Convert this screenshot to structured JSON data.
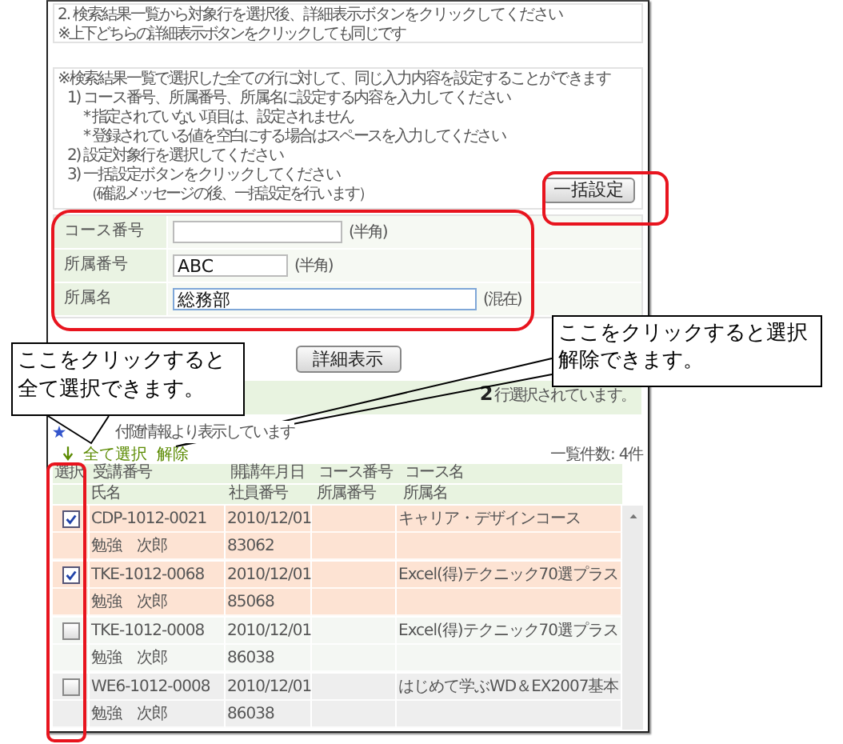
{
  "top_instructions": {
    "title": "2. 検索結果一覧から対象行を選択後、詳細表示ボタンをクリックしてください",
    "note": "※上下どちらの詳細表示ボタンをクリックしても同じです"
  },
  "bulk_instructions": [
    {
      "kind": "lead",
      "text": "※検索結果一覧で選択した全ての行に対して、同じ入力内容を設定することができます"
    },
    {
      "kind": "step",
      "text": "1) コース番号、所属番号、所属名に設定する内容を入力してください"
    },
    {
      "kind": "note",
      "text": "* 指定されていない項目は、設定されません"
    },
    {
      "kind": "note",
      "text": "* 登録されている値を空白にする場合はスペースを入力してください"
    },
    {
      "kind": "step",
      "text": "2) 設定対象行を選択してください"
    },
    {
      "kind": "step",
      "text": "3) 一括設定ボタンをクリックしてください"
    },
    {
      "kind": "note",
      "text": "（確認メッセージの後、一括設定を行います）"
    }
  ],
  "bulk_button": "一括設定",
  "form_fields": [
    {
      "label": "コース番号",
      "hint": "(半角)",
      "focused": false
    },
    {
      "label": "所属番号",
      "value": "ABC",
      "hint": "(半角)",
      "focused": false
    },
    {
      "label": "所属名",
      "value": "総務部",
      "hint": "(混在)",
      "focused": true
    }
  ],
  "detail_button": "詳細表示",
  "selection_status": "**2** 行選択されています。",
  "info_note": "付随情報より表示しています",
  "select_all_link": "全て選択",
  "clear_link": "解除",
  "count": "一覧件数: 4件",
  "table": {
    "select_heading": "選択",
    "header_rows": [
      [
        "受講番号",
        "開講年月日",
        "コース番号",
        "コース名"
      ],
      [
        "氏名",
        "社員番号",
        "所属番号",
        "所属名"
      ]
    ],
    "rows": [
      {
        "checked": true,
        "course_id": "CDP-1012-0021",
        "start_date": "2010/12/01",
        "course_name": "キャリア・デザインコース",
        "name": "勉強　次郎",
        "employee_no": "83062"
      },
      {
        "checked": true,
        "course_id": "TKE-1012-0068",
        "start_date": "2010/12/01",
        "course_name": "Excel(得)テクニック70選プラス",
        "name": "勉強　次郎",
        "employee_no": "85068"
      },
      {
        "checked": false,
        "course_id": "TKE-1012-0008",
        "start_date": "2010/12/01",
        "course_name": "Excel(得)テクニック70選プラス",
        "name": "勉強　次郎",
        "employee_no": "86038"
      },
      {
        "checked": false,
        "course_id": "WE6-1012-0008",
        "start_date": "2010/12/01",
        "course_name": "はじめて学ぶWD＆EX2007基本",
        "name": "勉強　次郎",
        "employee_no": "86038"
      }
    ]
  },
  "callouts": [
    {
      "text": "ここをクリックすると全て選択できます。"
    },
    {
      "text": "ここをクリックすると選択解除できます。"
    }
  ]
}
